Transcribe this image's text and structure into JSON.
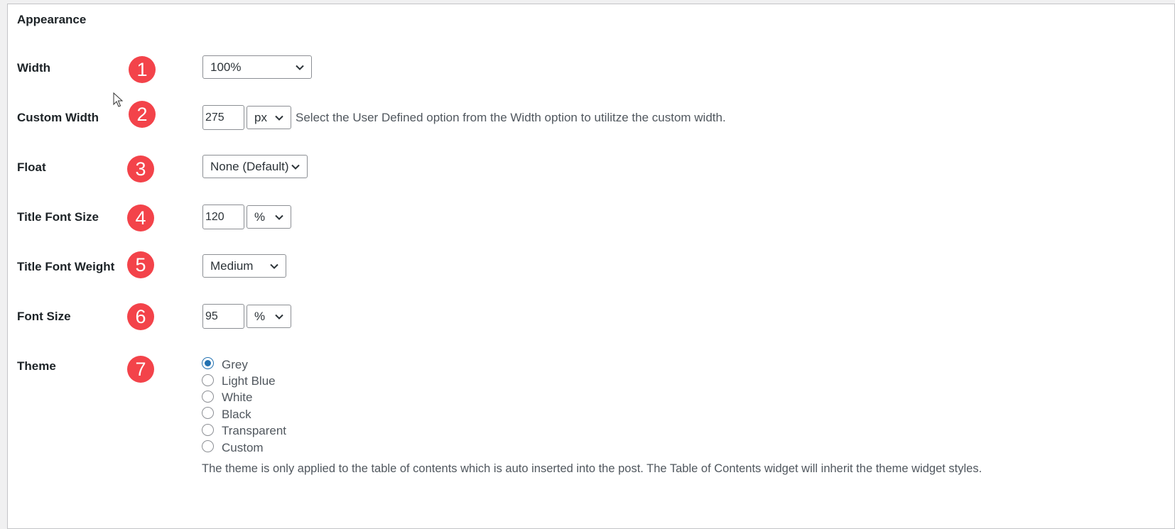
{
  "section": {
    "title": "Appearance"
  },
  "rows": {
    "width": {
      "label": "Width",
      "badge": "1",
      "value": "100%"
    },
    "custom_width": {
      "label": "Custom Width",
      "badge": "2",
      "value": "275",
      "unit": "px",
      "help": "Select the User Defined option from the Width option to utilitze the custom width."
    },
    "float": {
      "label": "Float",
      "badge": "3",
      "value": "None (Default)"
    },
    "title_font_size": {
      "label": "Title Font Size",
      "badge": "4",
      "value": "120",
      "unit": "%"
    },
    "title_font_weight": {
      "label": "Title Font Weight",
      "badge": "5",
      "value": "Medium"
    },
    "font_size": {
      "label": "Font Size",
      "badge": "6",
      "value": "95",
      "unit": "%"
    },
    "theme": {
      "label": "Theme",
      "badge": "7",
      "options": [
        "Grey",
        "Light Blue",
        "White",
        "Black",
        "Transparent",
        "Custom"
      ],
      "selected": "Grey",
      "description": "The theme is only applied to the table of contents which is auto inserted into the post. The Table of Contents widget will inherit the theme widget styles."
    }
  },
  "colors": {
    "badge": "#f3434a",
    "accent": "#2271b1"
  },
  "icons": {
    "select_arrow": "chevron-down-icon",
    "pointer": "mouse-cursor-icon"
  }
}
